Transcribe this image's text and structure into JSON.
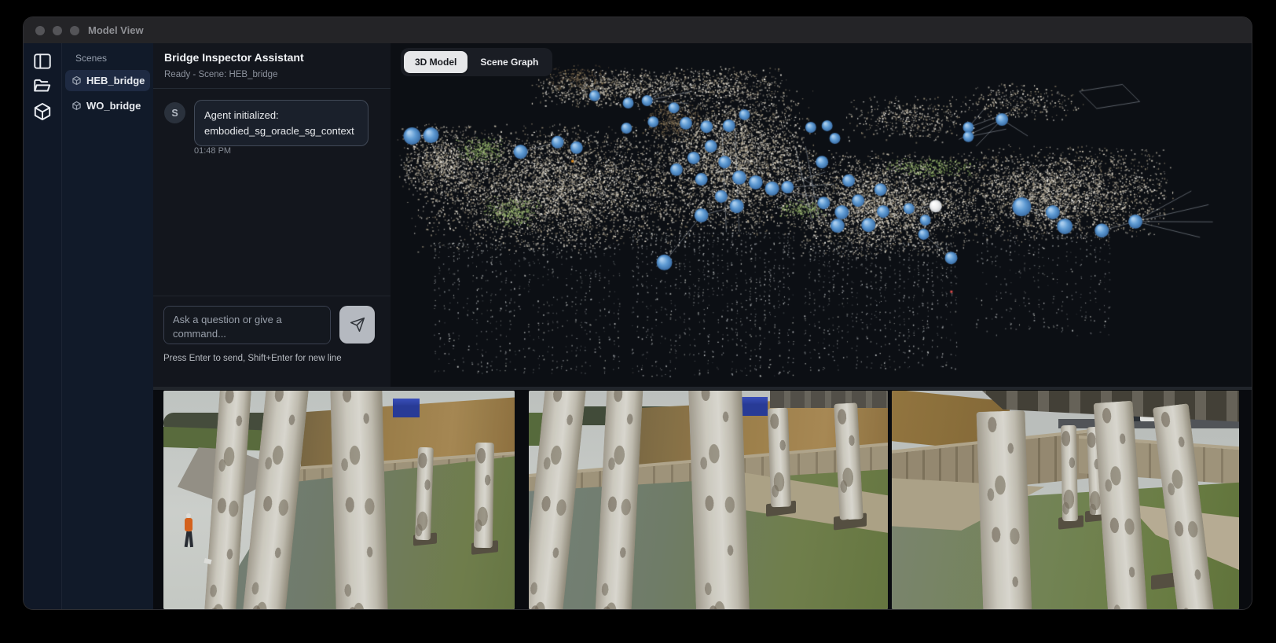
{
  "window": {
    "title": "Model View"
  },
  "colors": {
    "titlebar": "#242427",
    "panel_navy": "#111a29",
    "chat_bg": "#13161d",
    "viewer_bg": "#0c0f14",
    "node_blue": "#5f9bd3",
    "node_white": "#f2f2f2",
    "selected_item_bg": "#1e2a42",
    "active_tab_bg": "#e6e7e9"
  },
  "nav_rail": {
    "icons": [
      {
        "name": "panel-left-icon"
      },
      {
        "name": "folder-open-icon"
      },
      {
        "name": "cube-icon"
      }
    ]
  },
  "scenes_panel": {
    "header": "Scenes",
    "items": [
      {
        "label": "HEB_bridge",
        "icon": "cube-icon",
        "selected": true
      },
      {
        "label": "WO_bridge",
        "icon": "cube-icon",
        "selected": false
      }
    ]
  },
  "chat": {
    "title": "Bridge Inspector Assistant",
    "status": "Ready - Scene: HEB_bridge",
    "messages": [
      {
        "avatar": "S",
        "lines": [
          "Agent initialized:",
          "embodied_sg_oracle_sg_context"
        ],
        "time": "01:48 PM"
      }
    ],
    "input": {
      "placeholder": "Ask a question or give a command...",
      "hint": "Press Enter to send, Shift+Enter for new line",
      "send_icon": "paper-plane-icon"
    }
  },
  "viewer": {
    "tabs": [
      {
        "label": "3D Model",
        "active": true
      },
      {
        "label": "Scene Graph",
        "active": false
      }
    ],
    "node_color": "#5f9bd3",
    "white_node_color": "#f2f2f2",
    "white_node": [
      0.633,
      0.474,
      8
    ],
    "nodes": [
      [
        0.025,
        0.27,
        11
      ],
      [
        0.047,
        0.268,
        10
      ],
      [
        0.151,
        0.316,
        9
      ],
      [
        0.194,
        0.288,
        8
      ],
      [
        0.216,
        0.304,
        8
      ],
      [
        0.237,
        0.153,
        7
      ],
      [
        0.276,
        0.174,
        7
      ],
      [
        0.298,
        0.167,
        7
      ],
      [
        0.274,
        0.247,
        7
      ],
      [
        0.305,
        0.229,
        7
      ],
      [
        0.329,
        0.188,
        7
      ],
      [
        0.343,
        0.233,
        8
      ],
      [
        0.367,
        0.243,
        8
      ],
      [
        0.393,
        0.24,
        8
      ],
      [
        0.411,
        0.208,
        7
      ],
      [
        0.372,
        0.3,
        8
      ],
      [
        0.352,
        0.334,
        8
      ],
      [
        0.388,
        0.346,
        8
      ],
      [
        0.332,
        0.368,
        8
      ],
      [
        0.361,
        0.396,
        8
      ],
      [
        0.405,
        0.391,
        9
      ],
      [
        0.424,
        0.405,
        9
      ],
      [
        0.443,
        0.423,
        9
      ],
      [
        0.461,
        0.419,
        8
      ],
      [
        0.384,
        0.446,
        8
      ],
      [
        0.402,
        0.474,
        9
      ],
      [
        0.361,
        0.501,
        9
      ],
      [
        0.318,
        0.638,
        10
      ],
      [
        0.488,
        0.245,
        7
      ],
      [
        0.507,
        0.24,
        7
      ],
      [
        0.516,
        0.277,
        7
      ],
      [
        0.501,
        0.346,
        8
      ],
      [
        0.532,
        0.4,
        8
      ],
      [
        0.503,
        0.465,
        8
      ],
      [
        0.543,
        0.458,
        8
      ],
      [
        0.524,
        0.492,
        9
      ],
      [
        0.519,
        0.531,
        9
      ],
      [
        0.569,
        0.426,
        8
      ],
      [
        0.555,
        0.529,
        9
      ],
      [
        0.572,
        0.49,
        8
      ],
      [
        0.602,
        0.481,
        7
      ],
      [
        0.621,
        0.515,
        7
      ],
      [
        0.619,
        0.556,
        7
      ],
      [
        0.651,
        0.625,
        8
      ],
      [
        0.671,
        0.245,
        7
      ],
      [
        0.671,
        0.272,
        7
      ],
      [
        0.71,
        0.222,
        8
      ],
      [
        0.733,
        0.476,
        12
      ],
      [
        0.769,
        0.492,
        9
      ],
      [
        0.783,
        0.533,
        10
      ],
      [
        0.826,
        0.545,
        9
      ],
      [
        0.865,
        0.519,
        9
      ]
    ]
  },
  "photo_strip": {
    "count": 3,
    "items": [
      {
        "name": "inspection-photo-1"
      },
      {
        "name": "inspection-photo-2"
      },
      {
        "name": "inspection-photo-3"
      }
    ]
  }
}
